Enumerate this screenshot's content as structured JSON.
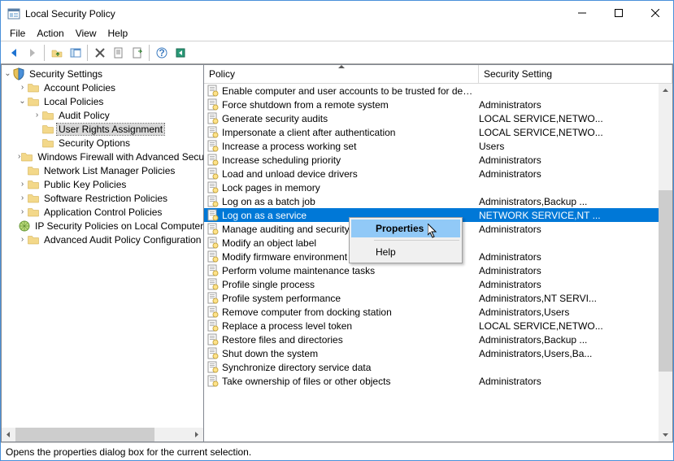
{
  "window": {
    "title": "Local Security Policy"
  },
  "menus": [
    "File",
    "Action",
    "View",
    "Help"
  ],
  "tree": {
    "root": "Security Settings",
    "items": [
      {
        "label": "Account Policies",
        "indent": 1,
        "twist": "›",
        "icon": "folder"
      },
      {
        "label": "Local Policies",
        "indent": 1,
        "twist": "⌄",
        "icon": "folder"
      },
      {
        "label": "Audit Policy",
        "indent": 2,
        "twist": "›",
        "icon": "folder"
      },
      {
        "label": "User Rights Assignment",
        "indent": 2,
        "twist": "",
        "icon": "folder",
        "selected": true
      },
      {
        "label": "Security Options",
        "indent": 2,
        "twist": "",
        "icon": "folder"
      },
      {
        "label": "Windows Firewall with Advanced Security",
        "indent": 1,
        "twist": "›",
        "icon": "folder"
      },
      {
        "label": "Network List Manager Policies",
        "indent": 1,
        "twist": "",
        "icon": "folder-net"
      },
      {
        "label": "Public Key Policies",
        "indent": 1,
        "twist": "›",
        "icon": "folder"
      },
      {
        "label": "Software Restriction Policies",
        "indent": 1,
        "twist": "›",
        "icon": "folder"
      },
      {
        "label": "Application Control Policies",
        "indent": 1,
        "twist": "›",
        "icon": "folder"
      },
      {
        "label": "IP Security Policies on Local Computer",
        "indent": 1,
        "twist": "",
        "icon": "ipsec"
      },
      {
        "label": "Advanced Audit Policy Configuration",
        "indent": 1,
        "twist": "›",
        "icon": "folder"
      }
    ]
  },
  "columns": {
    "policy": "Policy",
    "setting": "Security Setting"
  },
  "policies": [
    {
      "name": "Enable computer and user accounts to be trusted for delega...",
      "setting": ""
    },
    {
      "name": "Force shutdown from a remote system",
      "setting": "Administrators"
    },
    {
      "name": "Generate security audits",
      "setting": "LOCAL SERVICE,NETWO..."
    },
    {
      "name": "Impersonate a client after authentication",
      "setting": "LOCAL SERVICE,NETWO..."
    },
    {
      "name": "Increase a process working set",
      "setting": "Users"
    },
    {
      "name": "Increase scheduling priority",
      "setting": "Administrators"
    },
    {
      "name": "Load and unload device drivers",
      "setting": "Administrators"
    },
    {
      "name": "Lock pages in memory",
      "setting": ""
    },
    {
      "name": "Log on as a batch job",
      "setting": "Administrators,Backup ..."
    },
    {
      "name": "Log on as a service",
      "setting": "NETWORK SERVICE,NT ...",
      "selected": true
    },
    {
      "name": "Manage auditing and security l",
      "setting": "Administrators"
    },
    {
      "name": "Modify an object label",
      "setting": ""
    },
    {
      "name": "Modify firmware environment v",
      "setting": "Administrators"
    },
    {
      "name": "Perform volume maintenance tasks",
      "setting": "Administrators"
    },
    {
      "name": "Profile single process",
      "setting": "Administrators"
    },
    {
      "name": "Profile system performance",
      "setting": "Administrators,NT SERVI..."
    },
    {
      "name": "Remove computer from docking station",
      "setting": "Administrators,Users"
    },
    {
      "name": "Replace a process level token",
      "setting": "LOCAL SERVICE,NETWO..."
    },
    {
      "name": "Restore files and directories",
      "setting": "Administrators,Backup ..."
    },
    {
      "name": "Shut down the system",
      "setting": "Administrators,Users,Ba..."
    },
    {
      "name": "Synchronize directory service data",
      "setting": ""
    },
    {
      "name": "Take ownership of files or other objects",
      "setting": "Administrators"
    }
  ],
  "context_menu": {
    "properties": "Properties",
    "help": "Help"
  },
  "status": "Opens the properties dialog box for the current selection."
}
